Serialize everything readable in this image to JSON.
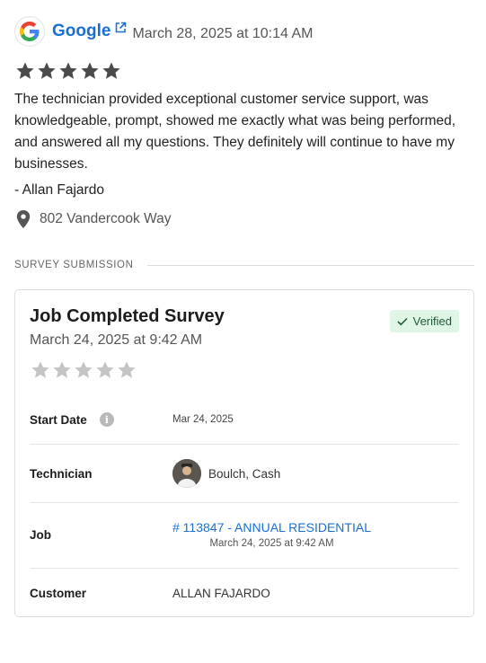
{
  "review": {
    "source_icon": "google-logo",
    "source_name": "Google",
    "external_link_icon": "external-link-icon",
    "date": "March 28, 2025 at 10:14 AM",
    "rating": 5,
    "star_color": "#4a4a4a",
    "text": "The technician provided exceptional customer service support, was knowledgeable, prompt, showed me exactly what was being performed, and answered all my questions.  They definitely will continue to have my businesses.",
    "author": "- Allan Fajardo",
    "location_icon": "map-pin-icon",
    "location": "802 Vandercook Way"
  },
  "section": {
    "label": "SURVEY SUBMISSION"
  },
  "survey": {
    "title": "Job Completed Survey",
    "date": "March 24, 2025 at 9:42 AM",
    "verified_label": "Verified",
    "verified_bg": "#dff5e6",
    "rating": 0,
    "empty_star_color": "#c4c4c4",
    "rows": {
      "start_date": {
        "label": "Start Date",
        "value": "Mar 24, 2025"
      },
      "technician": {
        "label": "Technician",
        "value": "Boulch, Cash"
      },
      "job": {
        "label": "Job",
        "link": "# 113847 - ANNUAL RESIDENTIAL",
        "date": "March 24, 2025 at 9:42 AM"
      },
      "customer": {
        "label": "Customer",
        "value": "ALLAN FAJARDO"
      }
    }
  },
  "colors": {
    "link": "#1a6fd1",
    "text": "#222222",
    "muted": "#555555"
  }
}
